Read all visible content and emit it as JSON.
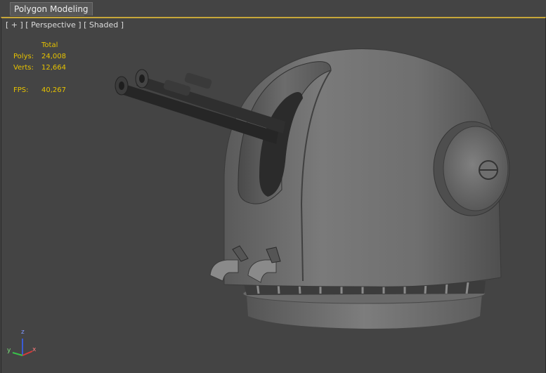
{
  "toolbar": {
    "active_tab": "Polygon Modeling"
  },
  "viewport": {
    "label": "[ + ] [ Perspective ] [ Shaded ]",
    "stats": {
      "header": "Total",
      "polys_label": "Polys:",
      "polys_value": "24,008",
      "verts_label": "Verts:",
      "verts_value": "12,664",
      "fps_label": "FPS:",
      "fps_value": "40,267"
    },
    "axis": {
      "x": "x",
      "y": "y",
      "z": "z"
    }
  },
  "colors": {
    "viewport_bg": "#444444",
    "active_border": "#c7a73a",
    "stats_text": "#e6c200"
  }
}
